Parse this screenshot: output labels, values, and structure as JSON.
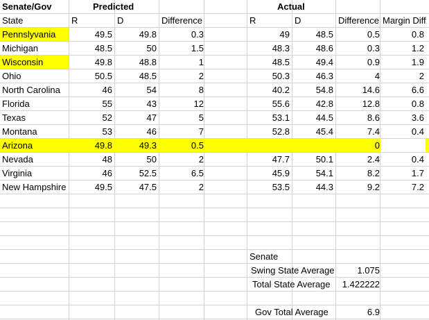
{
  "headers": {
    "title_cell": "Senate/Gov",
    "predicted_group": "Predicted",
    "actual_group": "Actual",
    "columns": [
      "State",
      "R",
      "D",
      "Difference",
      "R",
      "D",
      "Difference",
      "Margin Diff"
    ]
  },
  "rows": [
    {
      "state": "Pennslyvania",
      "pr": "49.5",
      "pd": "49.8",
      "pdiff": "0.3",
      "ar": "49",
      "ad": "48.5",
      "adiff": "0.5",
      "margin": "0.8",
      "highlight_state": true,
      "highlight_predicted": false
    },
    {
      "state": "Michigan",
      "pr": "48.5",
      "pd": "50",
      "pdiff": "1.5",
      "ar": "48.3",
      "ad": "48.6",
      "adiff": "0.3",
      "margin": "1.2",
      "highlight_state": false,
      "highlight_predicted": false
    },
    {
      "state": "Wisconsin",
      "pr": "49.8",
      "pd": "48.8",
      "pdiff": "1",
      "ar": "48.5",
      "ad": "49.4",
      "adiff": "0.9",
      "margin": "1.9",
      "highlight_state": true,
      "highlight_predicted": false
    },
    {
      "state": "Ohio",
      "pr": "50.5",
      "pd": "48.5",
      "pdiff": "2",
      "ar": "50.3",
      "ad": "46.3",
      "adiff": "4",
      "margin": "2",
      "highlight_state": false,
      "highlight_predicted": false
    },
    {
      "state": "North Carolina",
      "pr": "46",
      "pd": "54",
      "pdiff": "8",
      "ar": "40.2",
      "ad": "54.8",
      "adiff": "14.6",
      "margin": "6.6",
      "highlight_state": false,
      "highlight_predicted": false
    },
    {
      "state": "Florida",
      "pr": "55",
      "pd": "43",
      "pdiff": "12",
      "ar": "55.6",
      "ad": "42.8",
      "adiff": "12.8",
      "margin": "0.8",
      "highlight_state": false,
      "highlight_predicted": false
    },
    {
      "state": "Texas",
      "pr": "52",
      "pd": "47",
      "pdiff": "5",
      "ar": "53.1",
      "ad": "44.5",
      "adiff": "8.6",
      "margin": "3.6",
      "highlight_state": false,
      "highlight_predicted": false
    },
    {
      "state": "Montana",
      "pr": "53",
      "pd": "46",
      "pdiff": "7",
      "ar": "52.8",
      "ad": "45.4",
      "adiff": "7.4",
      "margin": "0.4",
      "highlight_state": false,
      "highlight_predicted": false
    },
    {
      "state": "Arizona",
      "pr": "49.8",
      "pd": "49.3",
      "pdiff": "0.5",
      "ar": "",
      "ad": "",
      "adiff": "0",
      "margin": "",
      "highlight_state": true,
      "highlight_predicted": true
    },
    {
      "state": "Nevada",
      "pr": "48",
      "pd": "50",
      "pdiff": "2",
      "ar": "47.7",
      "ad": "50.1",
      "adiff": "2.4",
      "margin": "0.4",
      "highlight_state": false,
      "highlight_predicted": false
    },
    {
      "state": "Virginia",
      "pr": "46",
      "pd": "52.5",
      "pdiff": "6.5",
      "ar": "45.9",
      "ad": "54.1",
      "adiff": "8.2",
      "margin": "1.7",
      "highlight_state": false,
      "highlight_predicted": false
    },
    {
      "state": "New Hampshire",
      "pr": "49.5",
      "pd": "47.5",
      "pdiff": "2",
      "ar": "53.5",
      "ad": "44.3",
      "adiff": "9.2",
      "margin": "7.2",
      "highlight_state": false,
      "highlight_predicted": false
    }
  ],
  "summary": {
    "senate_label": "Senate",
    "swing_label": "Swing State Average",
    "swing_value": "1.075",
    "total_label": "Total State Average",
    "total_value": "1.422222",
    "gov_label": "Gov Total Average",
    "gov_value": "6.9"
  },
  "colors": {
    "highlight": "#ffff00",
    "gridline": "#d4d4d4"
  }
}
